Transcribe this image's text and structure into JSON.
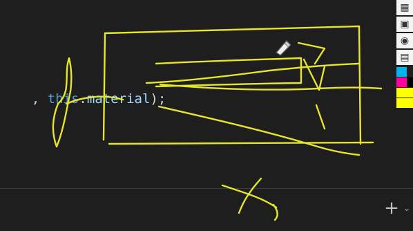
{
  "editor": {
    "code_tokens": [
      {
        "text": ", ",
        "kind": "punctuation"
      },
      {
        "text": "this",
        "kind": "keyword"
      },
      {
        "text": ".",
        "kind": "punctuation"
      },
      {
        "text": "material",
        "kind": "property"
      },
      {
        "text": ");",
        "kind": "punctuation"
      }
    ]
  },
  "panel": {
    "add_label": "+",
    "chevron_label": "⌄"
  },
  "toolbar": {
    "tools": [
      {
        "name": "printer-icon",
        "glyph": "▦"
      },
      {
        "name": "device-icon",
        "glyph": "▣"
      },
      {
        "name": "camera-icon",
        "glyph": "◉"
      },
      {
        "name": "clipboard-icon",
        "glyph": "▤"
      }
    ],
    "swatches": [
      "#00b4f0",
      "#ff00a0",
      "#000000",
      "#ffff00",
      "#ffff00",
      "#ffff00"
    ]
  },
  "annotation": {
    "stroke_color": "#e6e62a"
  },
  "colors": {
    "background": "#1e1e1e",
    "keyword": "#569cd6",
    "property": "#9cdcfe",
    "punctuation": "#d4d4d4"
  }
}
